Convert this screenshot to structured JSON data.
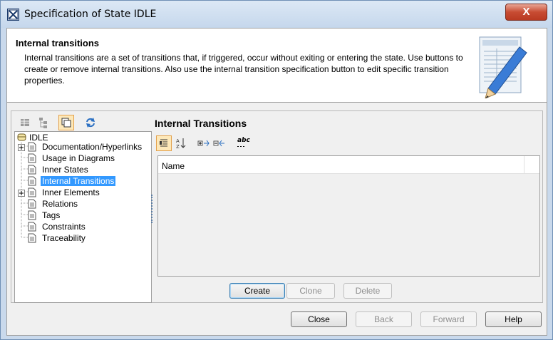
{
  "window": {
    "title": "Specification of State IDLE",
    "close_label": "X"
  },
  "header": {
    "title": "Internal transitions",
    "description": "Internal transitions are a set of transitions that, if triggered, occur without exiting or entering the state. Use buttons to create or remove internal transitions. Also use the internal transition specification button to edit specific transition properties."
  },
  "tree": {
    "root": "IDLE",
    "items": [
      {
        "label": "Documentation/Hyperlinks",
        "expandable": true,
        "selected": false
      },
      {
        "label": "Usage in Diagrams",
        "expandable": false,
        "selected": false
      },
      {
        "label": "Inner States",
        "expandable": false,
        "selected": false
      },
      {
        "label": "Internal Transitions",
        "expandable": false,
        "selected": true
      },
      {
        "label": "Inner Elements",
        "expandable": true,
        "selected": false
      },
      {
        "label": "Relations",
        "expandable": false,
        "selected": false
      },
      {
        "label": "Tags",
        "expandable": false,
        "selected": false
      },
      {
        "label": "Constraints",
        "expandable": false,
        "selected": false
      },
      {
        "label": "Traceability",
        "expandable": false,
        "selected": false
      }
    ]
  },
  "panel": {
    "title": "Internal Transitions",
    "column_name": "Name",
    "abc_label": "abc"
  },
  "table_buttons": {
    "create": "Create",
    "clone": "Clone",
    "delete": "Delete"
  },
  "footer_buttons": {
    "close": "Close",
    "back": "Back",
    "forward": "Forward",
    "help": "Help"
  },
  "colors": {
    "selection": "#3399ff",
    "close_button": "#c84c33",
    "active_toolbar": "#fde8b9"
  }
}
